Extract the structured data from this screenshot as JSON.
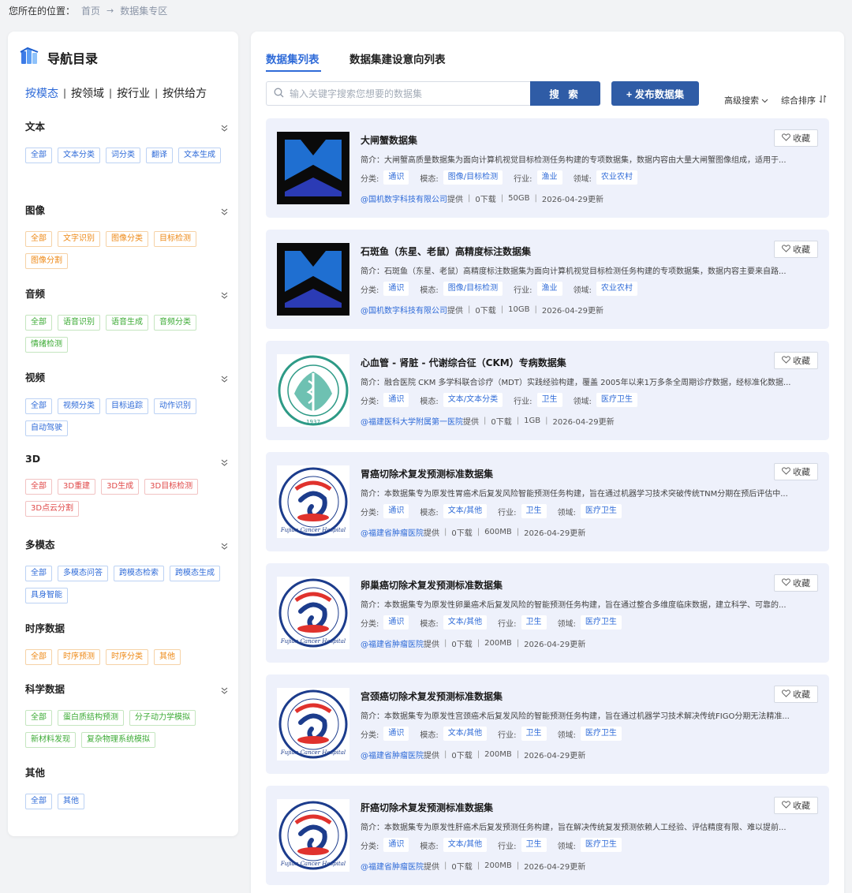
{
  "breadcrumb": {
    "label": "您所在的位置：",
    "home": "首页",
    "arrow": "→",
    "current": "数据集专区"
  },
  "sidebar": {
    "title": "导航目录",
    "filter_tabs": [
      "按模态",
      "按领域",
      "按行业",
      "按供给方"
    ],
    "categories": [
      {
        "name": "文本",
        "color": "blue",
        "tags": [
          "全部",
          "文本分类",
          "词分类",
          "翻译",
          "文本生成"
        ]
      },
      {
        "name": "图像",
        "color": "orange",
        "tags": [
          "全部",
          "文字识别",
          "图像分类",
          "目标检测",
          "图像分割"
        ]
      },
      {
        "name": "音频",
        "color": "green",
        "tags": [
          "全部",
          "语音识别",
          "语音生成",
          "音频分类",
          "情绪检测"
        ]
      },
      {
        "name": "视频",
        "color": "blue",
        "tags": [
          "全部",
          "视频分类",
          "目标追踪",
          "动作识别",
          "自动驾驶"
        ]
      },
      {
        "name": "3D",
        "color": "red",
        "tags": [
          "全部",
          "3D重建",
          "3D生成",
          "3D目标检测",
          "3D点云分割"
        ]
      },
      {
        "name": "多模态",
        "color": "blue",
        "tags": [
          "全部",
          "多模态问答",
          "跨模态检索",
          "跨模态生成",
          "具身智能"
        ]
      },
      {
        "name": "时序数据",
        "color": "orange",
        "tags": [
          "全部",
          "时序预测",
          "时序分类",
          "其他"
        ]
      },
      {
        "name": "科学数据",
        "color": "green",
        "tags": [
          "全部",
          "蛋白质结构预测",
          "分子动力学模拟",
          "新材料发现",
          "复杂物理系统模拟"
        ]
      },
      {
        "name": "其他",
        "color": "blue",
        "tags": [
          "全部",
          "其他"
        ]
      }
    ]
  },
  "main": {
    "tabs": [
      "数据集列表",
      "数据集建设意向列表"
    ],
    "search_placeholder": "输入关键字搜索您想要的数据集",
    "search_button": "搜 索",
    "publish_button": "+ 发布数据集",
    "advanced": "高级搜索",
    "sort": "综合排序",
    "labels": {
      "category": "分类:",
      "modality": "模态:",
      "industry": "行业:",
      "domain": "领域:",
      "intro": "简介：",
      "fav": "收藏"
    },
    "datasets": [
      {
        "title": "大闸蟹数据集",
        "logo": "blue-chevron",
        "desc": "简介：大闸蟹高质量数据集为面向计算机视觉目标检测任务构建的专项数据集，数据内容由大量大闸蟹图像组成，适用于...",
        "category": "通识",
        "modality": "图像/目标检测",
        "industry": "渔业",
        "domain": "农业农村",
        "provider": "@国机数字科技有限公司",
        "provided": "提供",
        "downloads": "0下载",
        "size": "50GB",
        "updated": "2026-04-29更新"
      },
      {
        "title": "石斑鱼（东星、老鼠）高精度标注数据集",
        "logo": "blue-chevron",
        "desc": "简介：石斑鱼（东星、老鼠）高精度标注数据集为面向计算机视觉目标检测任务构建的专项数据集，数据内容主要来自路...",
        "category": "通识",
        "modality": "图像/目标检测",
        "industry": "渔业",
        "domain": "农业农村",
        "provider": "@国机数字科技有限公司",
        "provided": "提供",
        "downloads": "0下载",
        "size": "10GB",
        "updated": "2026-04-29更新"
      },
      {
        "title": "心血管 - 肾脏 - 代谢综合征（CKM）专病数据集",
        "logo": "green-seal",
        "desc": "简介：融合医院 CKM 多学科联合诊疗（MDT）实践经验构建，覆盖 2005年以来1万多条全周期诊疗数据，经标准化数据...",
        "category": "通识",
        "modality": "文本/文本分类",
        "industry": "卫生",
        "domain": "医疗卫生",
        "provider": "@福建医科大学附属第一医院",
        "provided": "提供",
        "downloads": "0下载",
        "size": "1GB",
        "updated": "2026-04-29更新"
      },
      {
        "title": "胃癌切除术复发预测标准数据集",
        "logo": "cancer-hospital",
        "desc": "简介：本数据集专为原发性胃癌术后复发风险智能预测任务构建，旨在通过机器学习技术突破传统TNM分期在预后评估中...",
        "category": "通识",
        "modality": "文本/其他",
        "industry": "卫生",
        "domain": "医疗卫生",
        "provider": "@福建省肿瘤医院",
        "provided": "提供",
        "downloads": "0下载",
        "size": "600MB",
        "updated": "2026-04-29更新"
      },
      {
        "title": "卵巢癌切除术复发预测标准数据集",
        "logo": "cancer-hospital",
        "desc": "简介：本数据集专为原发性卵巢癌术后复发风险的智能预测任务构建，旨在通过整合多维度临床数据，建立科学、可靠的...",
        "category": "通识",
        "modality": "文本/其他",
        "industry": "卫生",
        "domain": "医疗卫生",
        "provider": "@福建省肿瘤医院",
        "provided": "提供",
        "downloads": "0下载",
        "size": "200MB",
        "updated": "2026-04-29更新"
      },
      {
        "title": "宫颈癌切除术复发预测标准数据集",
        "logo": "cancer-hospital",
        "desc": "简介：本数据集专为原发性宫颈癌术后复发风险的智能预测任务构建，旨在通过机器学习技术解决传统FIGO分期无法精准...",
        "category": "通识",
        "modality": "文本/其他",
        "industry": "卫生",
        "domain": "医疗卫生",
        "provider": "@福建省肿瘤医院",
        "provided": "提供",
        "downloads": "0下载",
        "size": "200MB",
        "updated": "2026-04-29更新"
      },
      {
        "title": "肝癌切除术复发预测标准数据集",
        "logo": "cancer-hospital",
        "desc": "简介：本数据集专为原发性肝癌术后复发预测任务构建，旨在解决传统复发预测依赖人工经验、评估精度有限、难以提前...",
        "category": "通识",
        "modality": "文本/其他",
        "industry": "卫生",
        "domain": "医疗卫生",
        "provider": "@福建省肿瘤医院",
        "provided": "提供",
        "downloads": "0下载",
        "size": "200MB",
        "updated": "2026-04-29更新"
      }
    ]
  },
  "colors": {
    "accent": "#2f6bd8",
    "button": "#2f5ca6",
    "card_bg": "#eef1fb"
  },
  "logo_text": {
    "seal_year": "1937",
    "seal_ring": "福建医科大学附属第一医院",
    "cancer_cn": "福建省肿瘤医院",
    "cancer_en": "Fujian Cancer Hospital"
  }
}
